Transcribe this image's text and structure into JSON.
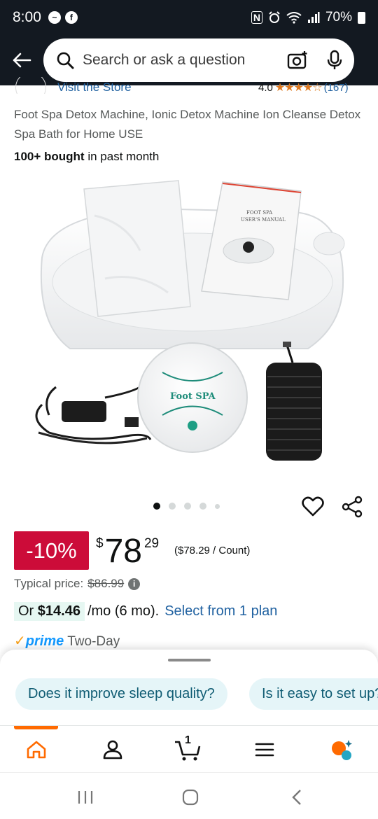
{
  "status_bar": {
    "time": "8:00",
    "left_icons": [
      "messenger-icon",
      "facebook-icon"
    ],
    "nfc_label": "N",
    "battery": "70%"
  },
  "search": {
    "placeholder": "Search or ask a question",
    "icons": [
      "back-arrow-icon",
      "search-icon",
      "camera-icon",
      "microphone-icon"
    ]
  },
  "store": {
    "link": "Visit the Store",
    "rating": "4.0",
    "stars": "★★★★☆",
    "count": "(167)"
  },
  "product": {
    "title": "Foot Spa Detox Machine, Ionic Detox Machine Ion Cleanse Detox Spa Bath for Home USE",
    "bought_bold": "100+ bought",
    "bought_rest": " in past month",
    "image_label": "Foot SPA",
    "manual_label_1": "FOOT SPA",
    "manual_label_2": "USER'S MANUAL"
  },
  "carousel": {
    "total_dots": 5,
    "active_index": 0
  },
  "price": {
    "discount": "-10%",
    "symbol": "$",
    "whole": "78",
    "fraction": "29",
    "unit_price": "($78.29 / Count)",
    "typical_label": "Typical price:",
    "typical_value": "$86.99",
    "info_glyph": "i"
  },
  "installment": {
    "prefix": "Or ",
    "amount": "$14.46",
    "rest": "/mo (6 mo).",
    "link": "Select from 1 plan"
  },
  "prime": {
    "check": "✓",
    "word": "prime",
    "delivery": "Two-Day"
  },
  "questions": {
    "chips": [
      "Does it improve sleep quality?",
      "Is it easy to set up?"
    ]
  },
  "tab_bar": {
    "tabs": [
      "home-icon",
      "account-icon",
      "cart-icon",
      "menu-icon",
      "rufus-icon"
    ],
    "cart_count": "1",
    "accent": "#ff6a00"
  },
  "colors": {
    "header_bg": "#131921",
    "discount_bg": "#cc0c39",
    "link": "#2162a1",
    "star": "#de7921",
    "chip_bg": "#e5f5f8"
  }
}
